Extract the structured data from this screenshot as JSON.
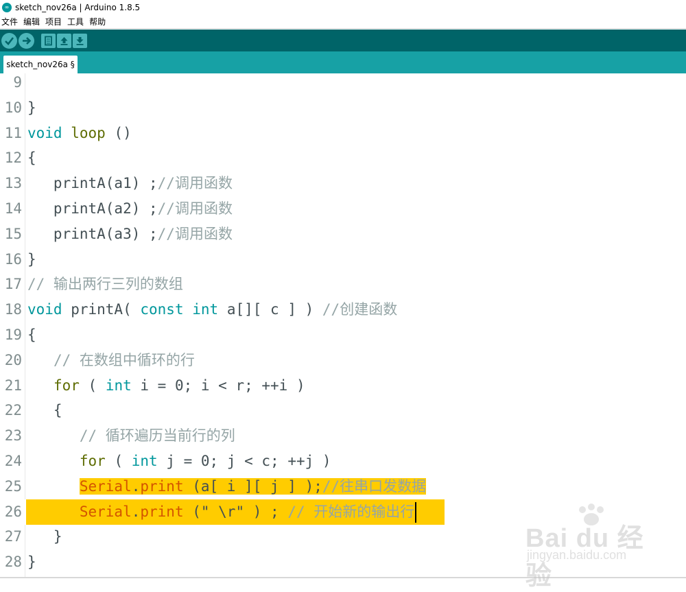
{
  "window": {
    "title": "sketch_nov26a | Arduino 1.8.5"
  },
  "menubar": {
    "items": [
      "文件",
      "编辑",
      "项目",
      "工具",
      "帮助"
    ]
  },
  "toolbar": {
    "buttons": [
      "verify-icon",
      "upload-icon",
      "new-icon",
      "open-icon",
      "save-icon"
    ]
  },
  "tabs": [
    {
      "label": "sketch_nov26a §"
    }
  ],
  "editor": {
    "lines": [
      {
        "n": "9",
        "text": ""
      },
      {
        "n": "10",
        "text": "}"
      },
      {
        "n": "11",
        "text": "void loop ()"
      },
      {
        "n": "12",
        "text": "{"
      },
      {
        "n": "13",
        "text": "   printA(a1) ;//调用函数"
      },
      {
        "n": "14",
        "text": "   printA(a2) ;//调用函数"
      },
      {
        "n": "15",
        "text": "   printA(a3) ;//调用函数"
      },
      {
        "n": "16",
        "text": "}"
      },
      {
        "n": "17",
        "text": "// 输出两行三列的数组"
      },
      {
        "n": "18",
        "text": "void printA( const int a[][ c ] ) //创建函数"
      },
      {
        "n": "19",
        "text": "{"
      },
      {
        "n": "20",
        "text": "   // 在数组中循环的行"
      },
      {
        "n": "21",
        "text": "   for ( int i = 0; i < r; ++i )"
      },
      {
        "n": "22",
        "text": "   {"
      },
      {
        "n": "23",
        "text": "      // 循环遍历当前行的列"
      },
      {
        "n": "24",
        "text": "      for ( int j = 0; j < c; ++j )"
      },
      {
        "n": "25",
        "text": "      Serial.print (a[ i ][ j ] );//往串口发数据"
      },
      {
        "n": "26",
        "text": "      Serial.print (\" \\r\" ) ; // 开始新的输出行"
      },
      {
        "n": "27",
        "text": "   }"
      },
      {
        "n": "28",
        "text": "}"
      }
    ],
    "highlight_color": "#ffcc00"
  },
  "watermark": {
    "brand": "Bai du 经验",
    "url": "jingyan.baidu.com"
  },
  "colors": {
    "toolbar": "#006468",
    "tabbar": "#17a1a5",
    "keyword_type": "#00979c",
    "keyword_func": "#5e6d03",
    "serial": "#d35400",
    "comment": "#95a5a6"
  }
}
